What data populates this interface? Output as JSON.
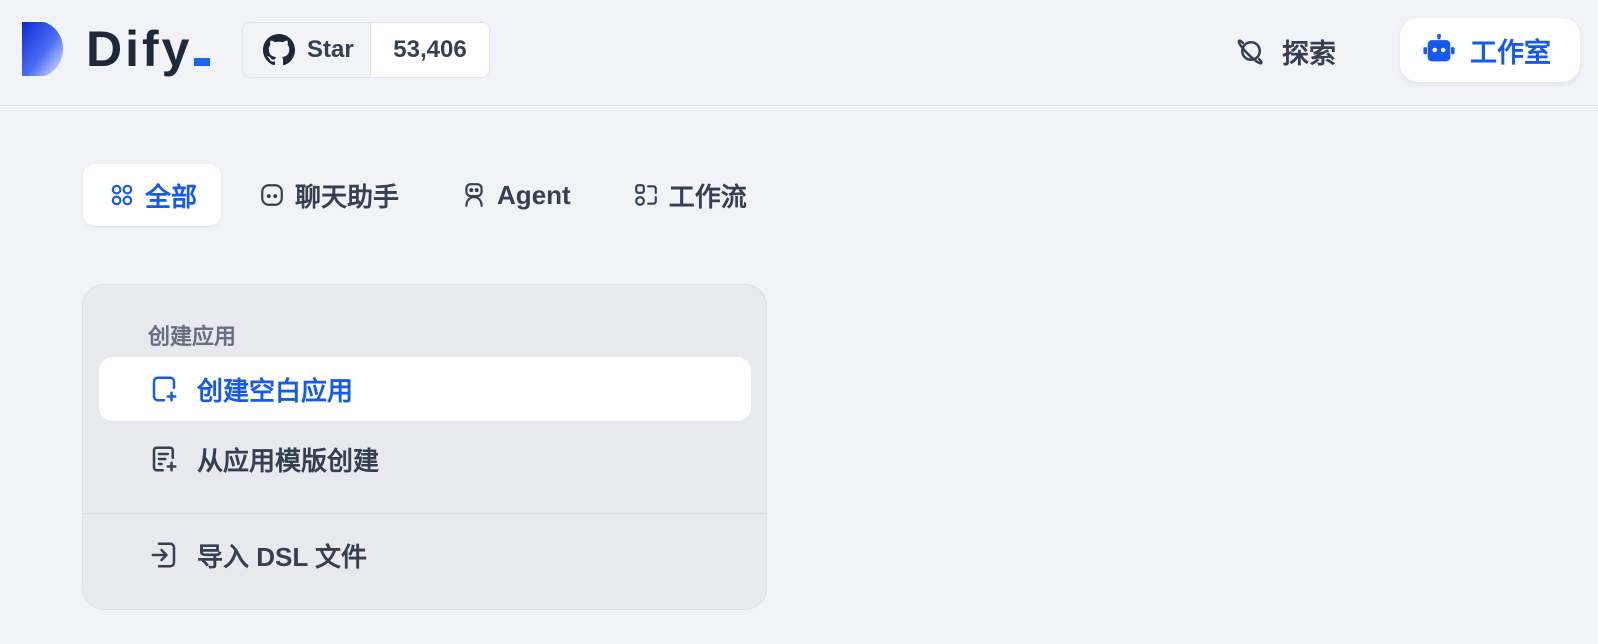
{
  "brand": {
    "name": "Dify",
    "accent": "#155aef"
  },
  "github": {
    "star_label": "Star",
    "count": "53,406"
  },
  "nav": {
    "explore": "探索",
    "studio": "工作室"
  },
  "tabs": [
    {
      "label": "全部",
      "icon": "grid-icon",
      "active": true
    },
    {
      "label": "聊天助手",
      "icon": "chat-bubble-icon",
      "active": false
    },
    {
      "label": "Agent",
      "icon": "robot-icon",
      "active": false
    },
    {
      "label": "工作流",
      "icon": "workflow-icon",
      "active": false
    }
  ],
  "create_card": {
    "title": "创建应用",
    "items": [
      {
        "label": "创建空白应用",
        "icon": "file-plus-icon",
        "highlighted": true
      },
      {
        "label": "从应用模版创建",
        "icon": "template-file-icon",
        "highlighted": false
      },
      {
        "label": "导入 DSL 文件",
        "icon": "import-icon",
        "highlighted": false
      }
    ]
  }
}
